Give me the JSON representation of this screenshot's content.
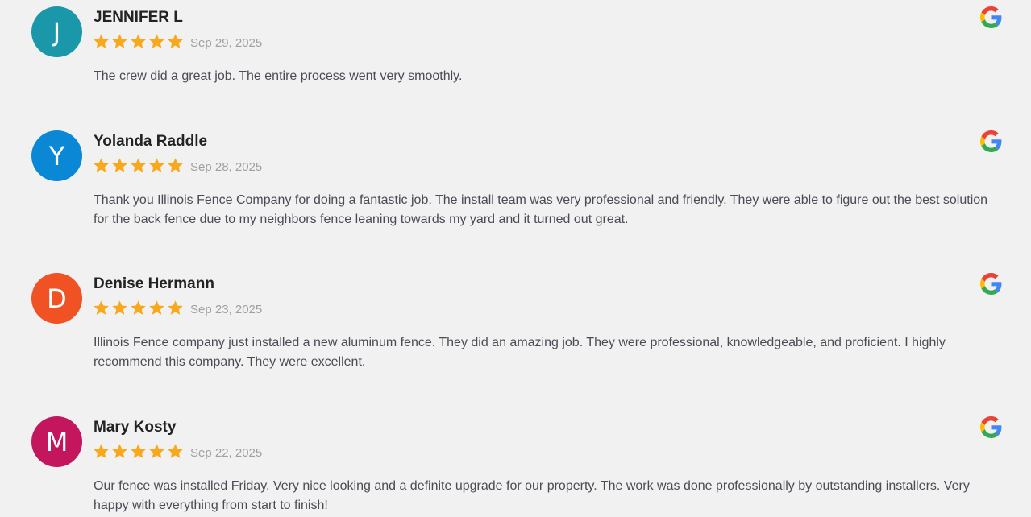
{
  "reviews": [
    {
      "initial": "J",
      "avatar_color": "#1a97a8",
      "name": "JENNIFER L",
      "rating": 5,
      "date": "Sep 29, 2025",
      "text": "The crew did a great job. The entire process went very smoothly.",
      "source_icon": "google-icon"
    },
    {
      "initial": "Y",
      "avatar_color": "#0a88d6",
      "name": "Yolanda Raddle",
      "rating": 5,
      "date": "Sep 28, 2025",
      "text": "Thank you Illinois Fence Company for doing a fantastic job. The install team was very professional and friendly. They were able to figure out the best solution for the back fence due to my neighbors fence leaning towards my yard and it turned out great.",
      "source_icon": "google-icon"
    },
    {
      "initial": "D",
      "avatar_color": "#f05223",
      "name": "Denise Hermann",
      "rating": 5,
      "date": "Sep 23, 2025",
      "text": "Illinois Fence company just installed a new aluminum fence. They did an amazing job. They were professional, knowledgeable, and proficient. I highly recommend this company. They were excellent.",
      "source_icon": "google-icon"
    },
    {
      "initial": "M",
      "avatar_color": "#c4165c",
      "name": "Mary Kosty",
      "rating": 5,
      "date": "Sep 22, 2025",
      "text": "Our fence was installed Friday. Very nice looking and a definite upgrade for our property. The work was done professionally by outstanding installers. Very happy with everything from start to finish!",
      "source_icon": "google-icon"
    }
  ],
  "colors": {
    "star": "#f9a71b",
    "background": "#f1f1f1"
  }
}
